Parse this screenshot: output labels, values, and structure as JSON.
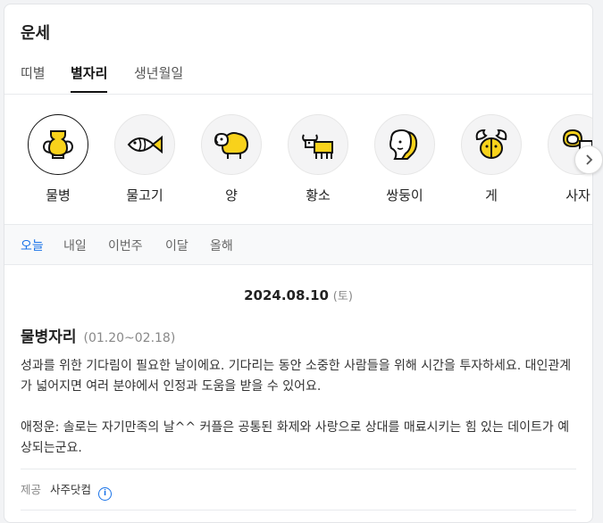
{
  "title": "운세",
  "tabs": [
    {
      "label": "띠별"
    },
    {
      "label": "별자리"
    },
    {
      "label": "생년월일"
    }
  ],
  "signs": [
    {
      "label": "물병",
      "icon": "aquarius-icon"
    },
    {
      "label": "물고기",
      "icon": "pisces-icon"
    },
    {
      "label": "양",
      "icon": "aries-icon"
    },
    {
      "label": "황소",
      "icon": "taurus-icon"
    },
    {
      "label": "쌍둥이",
      "icon": "gemini-icon"
    },
    {
      "label": "게",
      "icon": "cancer-icon"
    },
    {
      "label": "사자",
      "icon": "leo-icon"
    }
  ],
  "periods": [
    {
      "label": "오늘"
    },
    {
      "label": "내일"
    },
    {
      "label": "이번주"
    },
    {
      "label": "이달"
    },
    {
      "label": "올해"
    }
  ],
  "date": {
    "value": "2024.08.10",
    "weekday": "(토)"
  },
  "sign_detail": {
    "name": "물병자리",
    "range": "(01.20~02.18)"
  },
  "fortune": {
    "para1": "성과를 위한 기다림이 필요한 날이에요. 기다리는 동안 소중한 사람들을 위해 시간을 투자하세요. 대인관계가 넓어지면 여러 분야에서 인정과 도움을 받을 수 있어요.",
    "para2": "애정운: 솔로는 자기만족의 날^^ 커플은 공통된 화제와 사랑으로 상대를 매료시키는 힘 있는 데이트가 예상되는군요."
  },
  "footer": {
    "label": "제공",
    "provider": "사주닷컴",
    "info": "i"
  },
  "colors": {
    "accent": "#1a73e8",
    "icon_yellow": "#f8d21b"
  }
}
